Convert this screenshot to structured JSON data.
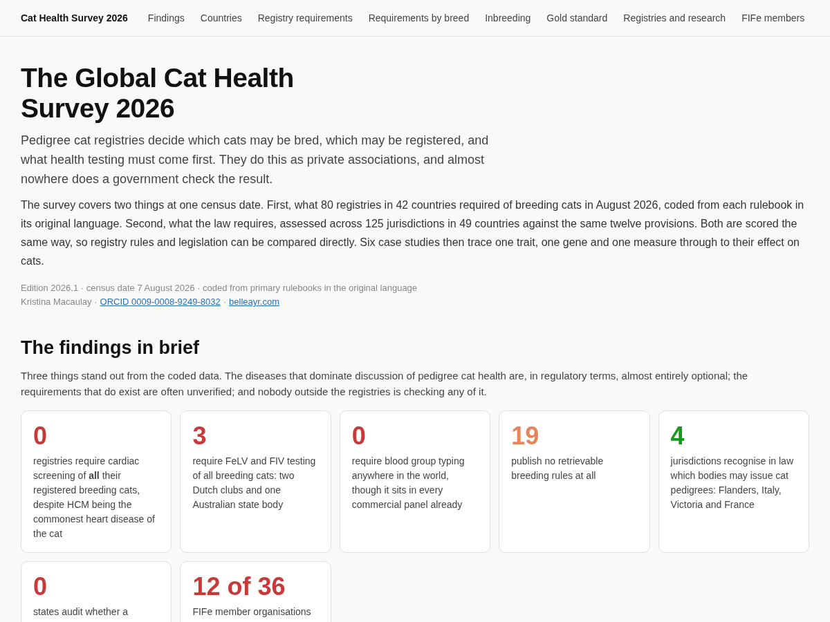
{
  "nav": {
    "brand": "Cat Health Survey 2026",
    "links": [
      "Findings",
      "Countries",
      "Registry requirements",
      "Requirements by breed",
      "Inbreeding",
      "Gold standard",
      "Registries and research",
      "FIFe members"
    ]
  },
  "header": {
    "title": "The Global Cat Health Survey 2026",
    "lede": "Pedigree cat registries decide which cats may be bred, which may be registered, and what health testing must come first. They do this as private associations, and almost nowhere does a government check the result.",
    "intro": "The survey covers two things at one census date. First, what 80 registries in 42 countries required of breeding cats in August 2026, coded from each rulebook in its original language. Second, what the law requires, assessed across 125 jurisdictions in 49 countries against the same twelve provisions. Both are scored the same way, so registry rules and legislation can be compared directly. Six case studies then trace one trait, one gene and one measure through to their effect on cats.",
    "edition": "Edition 2026.1 · census date 7 August 2026 · coded from primary rulebooks in the original language",
    "author": "Kristina Macaulay ·",
    "orcid": "ORCID 0009-0008-9249-8032",
    "sep": "·",
    "site": "belleayr.com"
  },
  "findings": {
    "heading": "The findings in brief",
    "summary": "Three things stand out from the coded data. The diseases that dominate discussion of pedigree cat health are, in regulatory terms, almost entirely optional; the requirements that do exist are often unverified; and nobody outside the registries is checking any of it.",
    "cards": [
      {
        "figure": "0",
        "color": "#c83a3a",
        "text": "registries require cardiac screening of **all** their registered breeding cats, despite HCM being the commonest heart disease of the cat"
      },
      {
        "figure": "3",
        "color": "#c83a3a",
        "text": "require FeLV and FIV testing of all breeding cats: two Dutch clubs and one Australian state body"
      },
      {
        "figure": "0",
        "color": "#c83a3a",
        "text": "require blood group typing anywhere in the world, though it sits in every commercial panel already"
      },
      {
        "figure": "19",
        "color": "#e8845a",
        "text": "publish no retrievable breeding rules at all"
      },
      {
        "figure": "4",
        "color": "#1a9a1a",
        "text": "jurisdictions recognise in law which bodies may issue cat pedigrees: Flanders, Italy, Victoria and France"
      },
      {
        "figure": "0",
        "color": "#c83a3a",
        "text": "states audit whether a"
      },
      {
        "figure": "12 of 36",
        "color": "#c83a3a",
        "text": "FIFe member organisations"
      }
    ]
  }
}
